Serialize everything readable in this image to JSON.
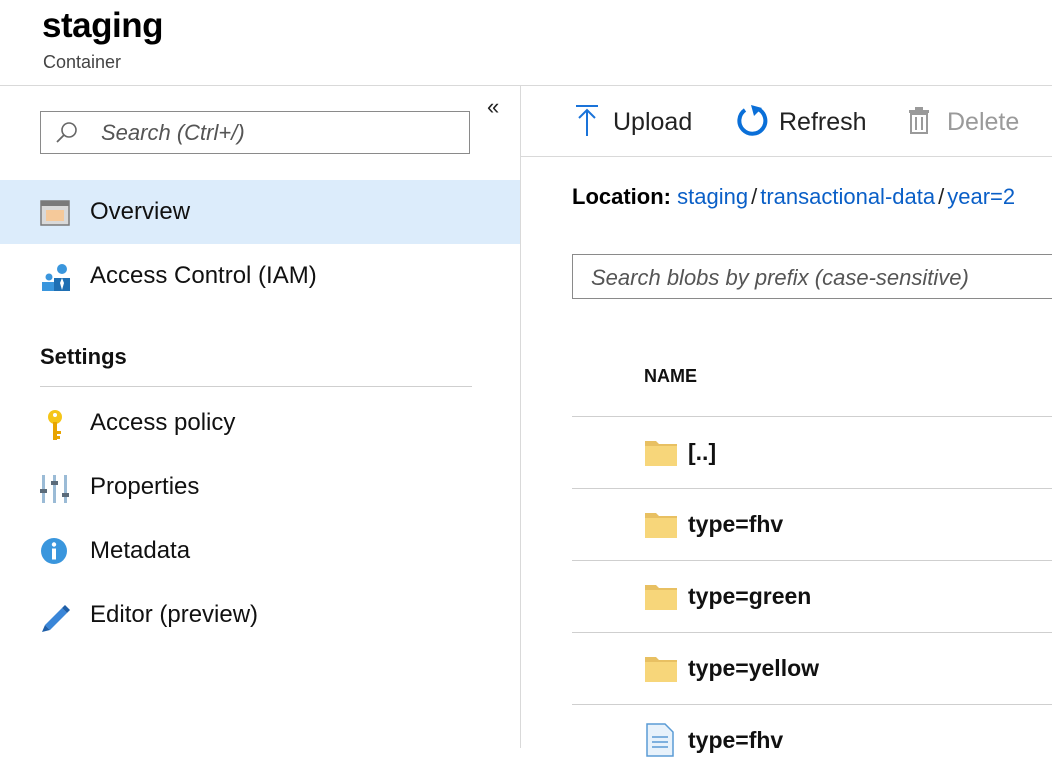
{
  "header": {
    "title": "staging",
    "subtitle": "Container"
  },
  "sidebar": {
    "search_placeholder": "Search (Ctrl+/)",
    "collapse_glyph": "«",
    "items": [
      {
        "label": "Overview",
        "icon": "overview-icon",
        "active": true
      },
      {
        "label": "Access Control (IAM)",
        "icon": "iam-users-icon",
        "active": false
      }
    ],
    "settings_heading": "Settings",
    "settings_items": [
      {
        "label": "Access policy",
        "icon": "key-icon"
      },
      {
        "label": "Properties",
        "icon": "properties-sliders-icon"
      },
      {
        "label": "Metadata",
        "icon": "info-icon"
      },
      {
        "label": "Editor (preview)",
        "icon": "pencil-icon"
      }
    ]
  },
  "toolbar": {
    "upload": "Upload",
    "refresh": "Refresh",
    "delete": "Delete"
  },
  "location": {
    "label": "Location:",
    "crumbs": [
      "staging",
      "transactional-data",
      "year=2"
    ],
    "separator": "/"
  },
  "blob_search": {
    "placeholder": "Search blobs by prefix (case-sensitive)"
  },
  "table": {
    "column_name": "NAME",
    "rows": [
      {
        "name": "[..]",
        "type": "folder"
      },
      {
        "name": "type=fhv",
        "type": "folder"
      },
      {
        "name": "type=green",
        "type": "folder"
      },
      {
        "name": "type=yellow",
        "type": "folder"
      },
      {
        "name": "type=fhv",
        "type": "file"
      }
    ]
  },
  "colors": {
    "accent": "#0a5fc7",
    "active_bg": "#dcecfb",
    "folder": "#f7d67a",
    "refresh_icon": "#0a6fd8"
  }
}
